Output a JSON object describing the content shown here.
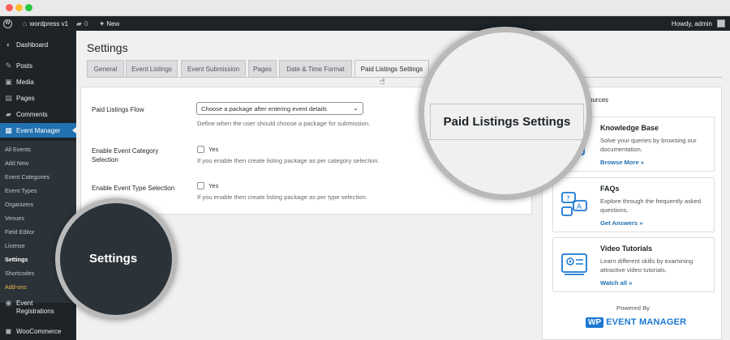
{
  "adminbar": {
    "site_name": "wordpress v1",
    "comments_count": "0",
    "new_label": "New",
    "howdy": "Howdy, admin"
  },
  "sidebar": {
    "items": {
      "dashboard": "Dashboard",
      "posts": "Posts",
      "media": "Media",
      "pages": "Pages",
      "comments": "Comments",
      "event_manager": "Event Manager",
      "event_registrations": "Event Registrations",
      "woocommerce": "WooCommerce"
    },
    "submenu": {
      "all_events": "All Events",
      "add_new": "Add New",
      "event_categories": "Event Categories",
      "event_types": "Event Types",
      "organizers": "Organizers",
      "venues": "Venues",
      "field_editor": "Field Editor",
      "license": "License",
      "settings": "Settings",
      "shortcodes": "Shortcodes",
      "addons": "Add-ons"
    }
  },
  "main": {
    "title": "Settings",
    "tabs": {
      "general": "General",
      "event_listings": "Event Listings",
      "event_submission": "Event Submission",
      "pages": "Pages",
      "date_time": "Date & Time Format",
      "paid_listings": "Paid Listings Settings"
    },
    "fields": {
      "flow_label": "Paid Listings Flow",
      "flow_value": "Choose a package after entering event details",
      "flow_desc": "Define when the user should choose a package for submission.",
      "category_label": "Enable Event Category Selection",
      "category_yes": "Yes",
      "category_desc": "If you enable then create listing package as per category selection.",
      "type_label": "Enable Event Type Selection",
      "type_yes": "Yes",
      "type_desc": "If you enable then create listing package as per type selection."
    }
  },
  "resources": {
    "heading": "sources",
    "knowledge": {
      "title": "Knowledge Base",
      "text": "Solve your queries by browsing our documentation.",
      "link": "Browse More »"
    },
    "faqs": {
      "title": "FAQs",
      "text": "Explore through the frequently asked questions.",
      "link": "Get Answers »"
    },
    "videos": {
      "title": "Video Tutorials",
      "text": "Learn different skills by examining attractive video tutorials.",
      "link": "Watch all »"
    },
    "powered_by": "Powered By",
    "brand_wp": "WP",
    "brand_name": "EVENT MANAGER"
  },
  "magnifier": {
    "large_label": "Paid Listings Settings",
    "small_label": "Settings"
  },
  "colors": {
    "accent": "#2271b1",
    "adminbar": "#1d2327",
    "addons": "#f0b849",
    "brand": "#1c78d3"
  }
}
